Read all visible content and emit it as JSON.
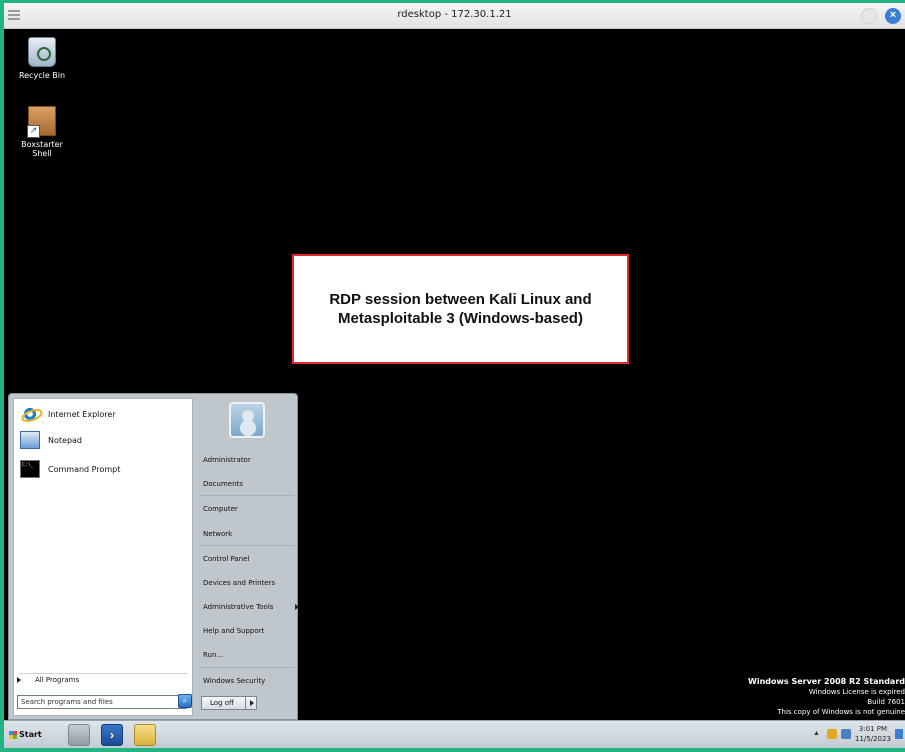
{
  "window": {
    "title": "rdesktop - 172.30.1.21"
  },
  "desktop": {
    "icons": [
      {
        "label": "Recycle Bin"
      },
      {
        "label": "Boxstarter\nShell"
      }
    ],
    "annotation": {
      "text": "RDP session between Kali Linux and Metasploitable 3 (Windows-based)"
    },
    "watermark": {
      "title": "Windows Server 2008 R2 Standard",
      "line1": "Windows License is expired",
      "line2": "Build 7601",
      "line3": "This copy of Windows is not genuine"
    }
  },
  "start_menu": {
    "programs": [
      {
        "label": "Internet Explorer",
        "icon": "internet-explorer-icon"
      },
      {
        "label": "Notepad",
        "icon": "notepad-icon"
      },
      {
        "label": "Command Prompt",
        "icon": "command-prompt-icon"
      }
    ],
    "all_programs": "All Programs",
    "search_placeholder": "Search programs and files",
    "right_items": [
      {
        "label": "Administrator"
      },
      {
        "label": "Documents"
      },
      {
        "label": "Computer"
      },
      {
        "label": "Network"
      },
      {
        "label": "Control Panel"
      },
      {
        "label": "Devices and Printers"
      },
      {
        "label": "Administrative Tools"
      },
      {
        "label": "Help and Support"
      },
      {
        "label": "Run..."
      },
      {
        "label": "Windows Security"
      }
    ],
    "logoff": "Log off"
  },
  "taskbar": {
    "start_label": "Start",
    "clock_time": "3:01 PM",
    "clock_date": "11/5/2023"
  },
  "colors": {
    "annotation_border": "#e0282f",
    "frame": "#22b583",
    "desktop": "#000000"
  }
}
